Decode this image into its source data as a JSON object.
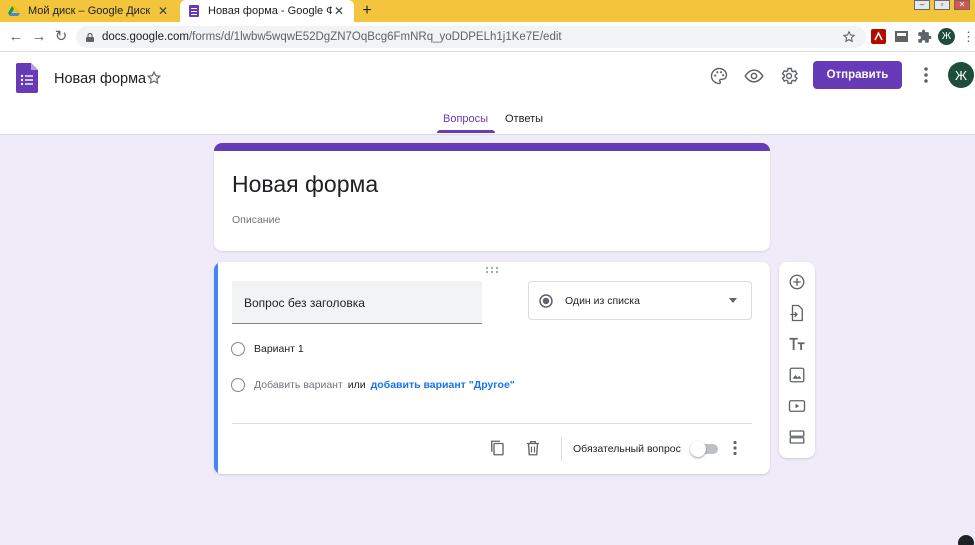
{
  "browser": {
    "tabs": [
      {
        "title": "Мой диск – Google Диск",
        "active": false
      },
      {
        "title": "Новая форма - Google Формы",
        "active": true
      }
    ],
    "url_host": "docs.google.com",
    "url_path": "/forms/d/1lwbw5wqwE52DgZN7OqBcg6FmNRq_yoDDPELh1j1Ke7E/edit",
    "colors": {
      "tabstrip": "#f2c53d"
    }
  },
  "header": {
    "doc_title": "Новая форма",
    "send_label": "Отправить",
    "avatar_letter": "Ж",
    "tabs": [
      {
        "label": "Вопросы",
        "active": true
      },
      {
        "label": "Ответы",
        "active": false
      }
    ]
  },
  "form": {
    "title": "Новая форма",
    "description_placeholder": "Описание"
  },
  "question": {
    "title_placeholder": "Вопрос без заголовка",
    "type": "Один из списка",
    "options": [
      "Вариант 1"
    ],
    "add_option": "Добавить вариант",
    "or_text": "или",
    "add_other": "добавить вариант \"Другое\"",
    "required_label": "Обязательный вопрос",
    "required": false
  },
  "colors": {
    "accent": "#673ab7",
    "background": "#f0ebf8",
    "active_card": "#4285f4",
    "link": "#1a73e8"
  },
  "icons": {
    "sidebar": [
      "add-question-icon",
      "import-questions-icon",
      "add-title-icon",
      "add-image-icon",
      "add-video-icon",
      "add-section-icon"
    ],
    "header": [
      "palette-icon",
      "preview-eye-icon",
      "settings-gear-icon",
      "more-vert-icon"
    ]
  }
}
